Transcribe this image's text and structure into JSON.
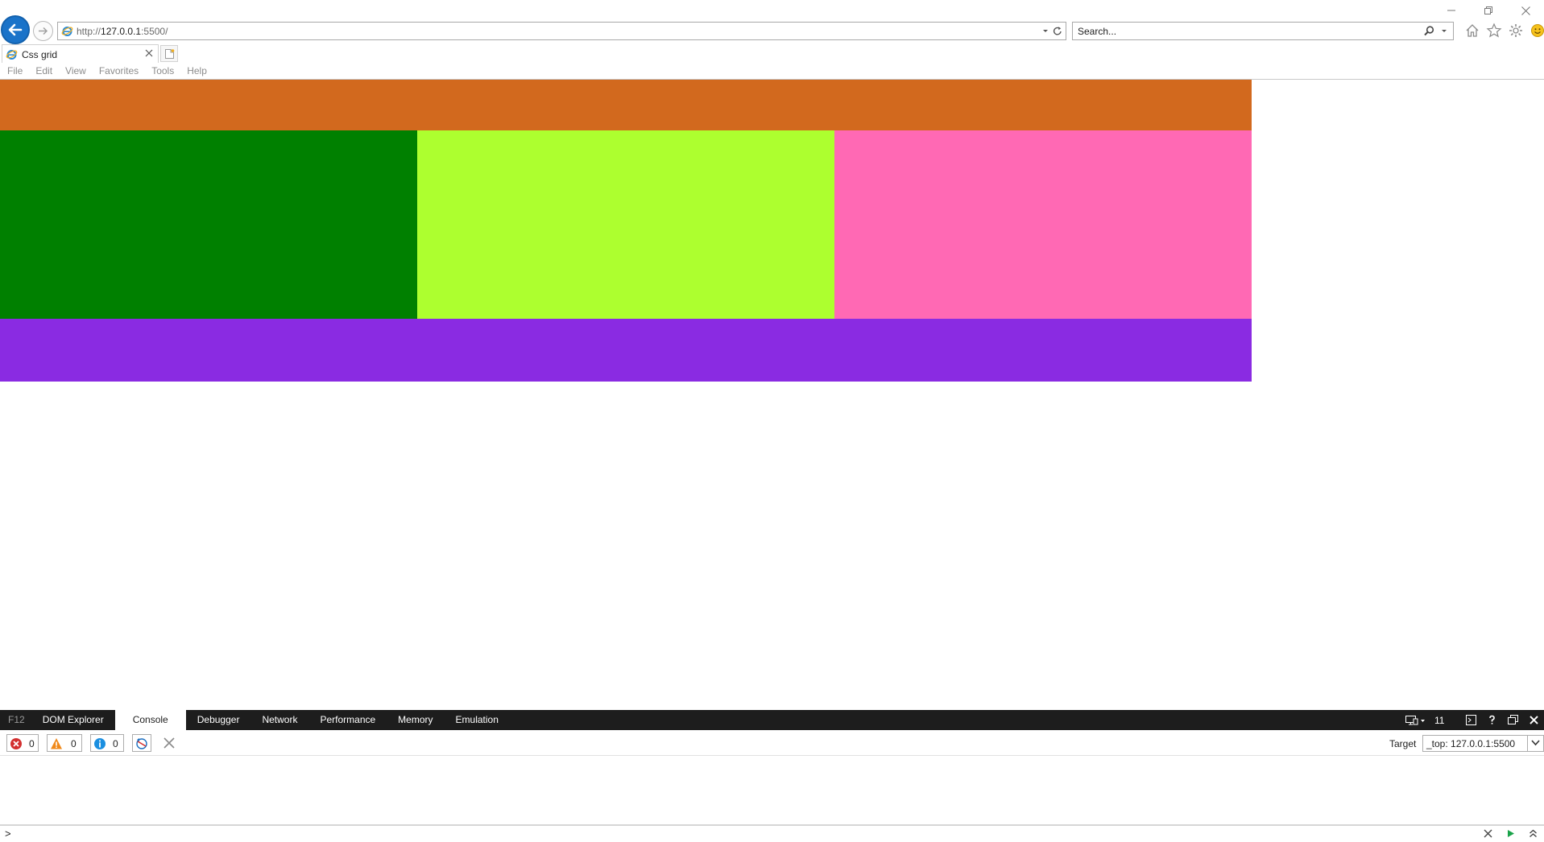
{
  "browser": {
    "address_scheme": "http://",
    "address_host": "127.0.0.1",
    "address_rest": ":5500/",
    "search_placeholder": "Search...",
    "tab_title": "Css grid",
    "menu": [
      "File",
      "Edit",
      "View",
      "Favorites",
      "Tools",
      "Help"
    ]
  },
  "page": {
    "grid_colors": {
      "header": "#d2691e",
      "col1": "#008000",
      "col2": "#adff2f",
      "col3": "#ff69b4",
      "footer": "#8a2be2"
    }
  },
  "devtools": {
    "f12_label": "F12",
    "tabs": [
      "DOM Explorer",
      "Console",
      "Debugger",
      "Network",
      "Performance",
      "Memory",
      "Emulation"
    ],
    "active_tab": "Console",
    "document_mode": "11",
    "errors": "0",
    "warnings": "0",
    "messages": "0",
    "target_label": "Target",
    "target_value": "_top: 127.0.0.1:5500",
    "prompt": ">"
  },
  "colors": {
    "accent_blue": "#1a73c9",
    "devtools_bar": "#1d1d1d",
    "error_red": "#d32f2f",
    "warning_orange": "#f0891a",
    "info_blue": "#1b8fe0"
  }
}
